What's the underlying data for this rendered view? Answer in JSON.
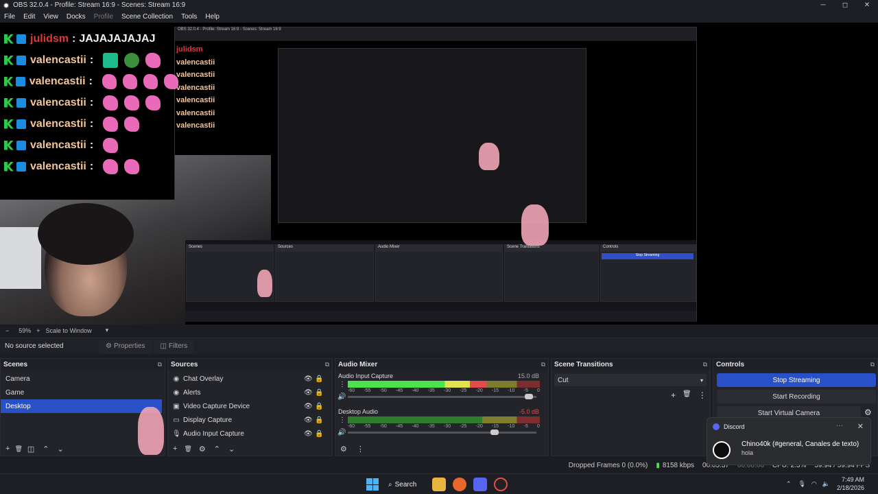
{
  "window": {
    "title": "OBS 32.0.4 - Profile: Stream 16:9 - Scenes: Stream 16:9",
    "minimize": "─",
    "maximize": "◻",
    "close": "✕"
  },
  "menu": [
    "File",
    "Edit",
    "View",
    "Docks",
    "Profile",
    "Scene Collection",
    "Tools",
    "Help"
  ],
  "chat": [
    {
      "user": "julidsm",
      "sep": ":",
      "text": "JAJAJAJAJAJ",
      "color": "#e2363a",
      "emotes": 0
    },
    {
      "user": "valencastii",
      "sep": ":",
      "text": "",
      "color": "#f2c59a",
      "emotes": 3
    },
    {
      "user": "valencastii",
      "sep": ":",
      "text": "",
      "color": "#f2c59a",
      "emotes": 4
    },
    {
      "user": "valencastii",
      "sep": ":",
      "text": "",
      "color": "#f2c59a",
      "emotes": 3
    },
    {
      "user": "valencastii",
      "sep": ":",
      "text": "",
      "color": "#f2c59a",
      "emotes": 2
    },
    {
      "user": "valencastii",
      "sep": ":",
      "text": "",
      "color": "#f2c59a",
      "emotes": 1
    },
    {
      "user": "valencastii",
      "sep": ":",
      "text": "",
      "color": "#f2c59a",
      "emotes": 2
    }
  ],
  "scale": {
    "zoom_minus": "−",
    "zoom": "59%",
    "zoom_plus": "+",
    "mode": "Scale to Window",
    "mode_chevron": "▾"
  },
  "source_toolbar": {
    "status": "No source selected",
    "properties": "Properties",
    "filters": "Filters"
  },
  "scenes": {
    "title": "Scenes",
    "items": [
      "Camera",
      "Game",
      "Desktop"
    ],
    "selected": "Desktop"
  },
  "sources": {
    "title": "Sources",
    "items": [
      {
        "label": "Chat Overlay",
        "icon": "◉"
      },
      {
        "label": "Alerts",
        "icon": "◉"
      },
      {
        "label": "Video Capture Device",
        "icon": "▣"
      },
      {
        "label": "Display Capture",
        "icon": "▭"
      },
      {
        "label": "Audio Input Capture",
        "icon": "🎙"
      }
    ]
  },
  "mixer": {
    "title": "Audio Mixer",
    "channels": [
      {
        "name": "Audio Input Capture",
        "db": "15.0 dB",
        "level": 0.72,
        "volume": 0.98
      },
      {
        "name": "Desktop Audio",
        "db": "-5.0 dB",
        "level": 0.0,
        "volume": 0.8
      }
    ],
    "ticks": [
      "-60",
      "-55",
      "-50",
      "-45",
      "-40",
      "-35",
      "-30",
      "-25",
      "-20",
      "-15",
      "-10",
      "-5",
      "0"
    ]
  },
  "transitions": {
    "title": "Scene Transitions",
    "selected": "Cut"
  },
  "controls": {
    "title": "Controls",
    "stop_streaming": "Stop Streaming",
    "start_recording": "Start Recording",
    "start_virtual_camera": "Start Virtual Camera",
    "gear": "⚙"
  },
  "status": {
    "dropped": "Dropped Frames 0 (0.0%)",
    "bitrate": "8158 kbps",
    "stream_time": "00:05:37",
    "rec_time": "00:00:00",
    "cpu": "CPU: 2.3%",
    "fps": "59.94 / 59.94 FPS"
  },
  "notification": {
    "app": "Discord",
    "more": "···",
    "close": "✕",
    "title": "Chino40k (#general, Canales de texto)",
    "body": "hola"
  },
  "taskbar": {
    "search": "Search",
    "time": "7:49 AM",
    "date": "2/18/2026",
    "tray_chevron": "⌃"
  },
  "dock_glyphs": {
    "menu": "⧉",
    "add": "+",
    "remove": "🗑",
    "filter": "◫",
    "up": "⌃",
    "down": "⌄",
    "gear": "⚙",
    "dots": "⋮",
    "eye": "👁",
    "lock": "🔒",
    "speaker": "🔊",
    "chevron": "▾"
  },
  "colors": {
    "accent": "#2a50c8",
    "panel": "#23242a",
    "background": "#1c1d22"
  }
}
